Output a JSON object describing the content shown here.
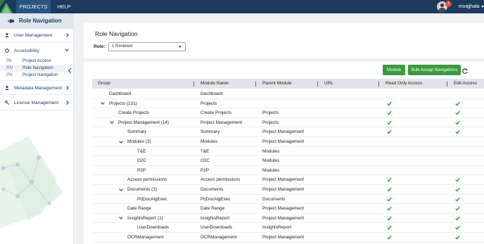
{
  "topbar": {
    "tabs": [
      {
        "label": "PROJECTS",
        "active": true
      },
      {
        "label": "HELP",
        "active": false
      }
    ],
    "notification_count": "1",
    "username": "mvajjhala"
  },
  "sidebar": {
    "title": "Role Navigation",
    "items": [
      {
        "label": "User Management",
        "icon": "user-icon"
      },
      {
        "label": "Accessibility",
        "icon": "accessibility-icon"
      },
      {
        "label": "Metadata Management",
        "icon": "user-icon"
      },
      {
        "label": "License Management",
        "icon": "key-icon"
      }
    ],
    "subitems": [
      {
        "abbr": "PA",
        "label": "Project Access"
      },
      {
        "abbr": "RN",
        "label": "Role Navigation"
      },
      {
        "abbr": "PN",
        "label": "Project Navigation"
      }
    ]
  },
  "role_card": {
    "heading": "Role Navigation",
    "role_label": "Role:",
    "role_value": "1 Reviewer"
  },
  "toolbar": {
    "module_label": "Module",
    "bulk_label": "Bulk Assign Navigations"
  },
  "grid": {
    "columns": [
      "Group",
      "Module Name",
      "Parent Module",
      "URL",
      "Read Only Access",
      "Edit Access"
    ],
    "rows": [
      {
        "group": "Dashboard",
        "indent": 0,
        "toggle": "",
        "module": "Dashboard",
        "parent": "",
        "read": false,
        "edit": false
      },
      {
        "group": "Projects (231)",
        "indent": 0,
        "toggle": "down",
        "module": "Projects",
        "parent": "",
        "read": true,
        "edit": true
      },
      {
        "group": "Create Projects",
        "indent": 1,
        "toggle": "",
        "module": "Create Projects",
        "parent": "Projects",
        "read": true,
        "edit": true
      },
      {
        "group": "Project Management (14)",
        "indent": 1,
        "toggle": "down",
        "module": "Project Management",
        "parent": "Projects",
        "read": true,
        "edit": true
      },
      {
        "group": "Summary",
        "indent": 2,
        "toggle": "",
        "module": "Summary",
        "parent": "Project Management",
        "read": true,
        "edit": true
      },
      {
        "group": "Modules (3)",
        "indent": 2,
        "toggle": "down",
        "module": "Modules",
        "parent": "Project Management",
        "read": false,
        "edit": false
      },
      {
        "group": "T&E",
        "indent": 3,
        "toggle": "",
        "module": "T&E",
        "parent": "Modules",
        "read": false,
        "edit": false
      },
      {
        "group": "O2C",
        "indent": 3,
        "toggle": "",
        "module": "O2C",
        "parent": "Modules",
        "read": false,
        "edit": false
      },
      {
        "group": "P2P",
        "indent": 3,
        "toggle": "",
        "module": "P2P",
        "parent": "Modules",
        "read": false,
        "edit": false
      },
      {
        "group": "Access permissions",
        "indent": 2,
        "toggle": "",
        "module": "Access permissions",
        "parent": "Project Management",
        "read": true,
        "edit": true
      },
      {
        "group": "Documents (1)",
        "indent": 2,
        "toggle": "down",
        "module": "Documents",
        "parent": "Project Management",
        "read": true,
        "edit": true
      },
      {
        "group": "PrjDocAlgExec",
        "indent": 3,
        "toggle": "",
        "module": "PrjDocAlgExec",
        "parent": "Documents",
        "read": true,
        "edit": true
      },
      {
        "group": "Date Range",
        "indent": 2,
        "toggle": "",
        "module": "Date Range",
        "parent": "Project Management",
        "read": true,
        "edit": true
      },
      {
        "group": "InsightsReport (1)",
        "indent": 2,
        "toggle": "down",
        "module": "InsightsReport",
        "parent": "Project Management",
        "read": true,
        "edit": true
      },
      {
        "group": "UserDownloads",
        "indent": 3,
        "toggle": "",
        "module": "UserDownloads",
        "parent": "InsightsReport",
        "read": true,
        "edit": true
      },
      {
        "group": "OCRManagement",
        "indent": 2,
        "toggle": "",
        "module": "OCRManagement",
        "parent": "Project Management",
        "read": true,
        "edit": true
      }
    ]
  },
  "colors": {
    "topbar": "#1b3a5c",
    "accent_green": "#3c9a3c",
    "check_green": "#2e9a3e"
  }
}
